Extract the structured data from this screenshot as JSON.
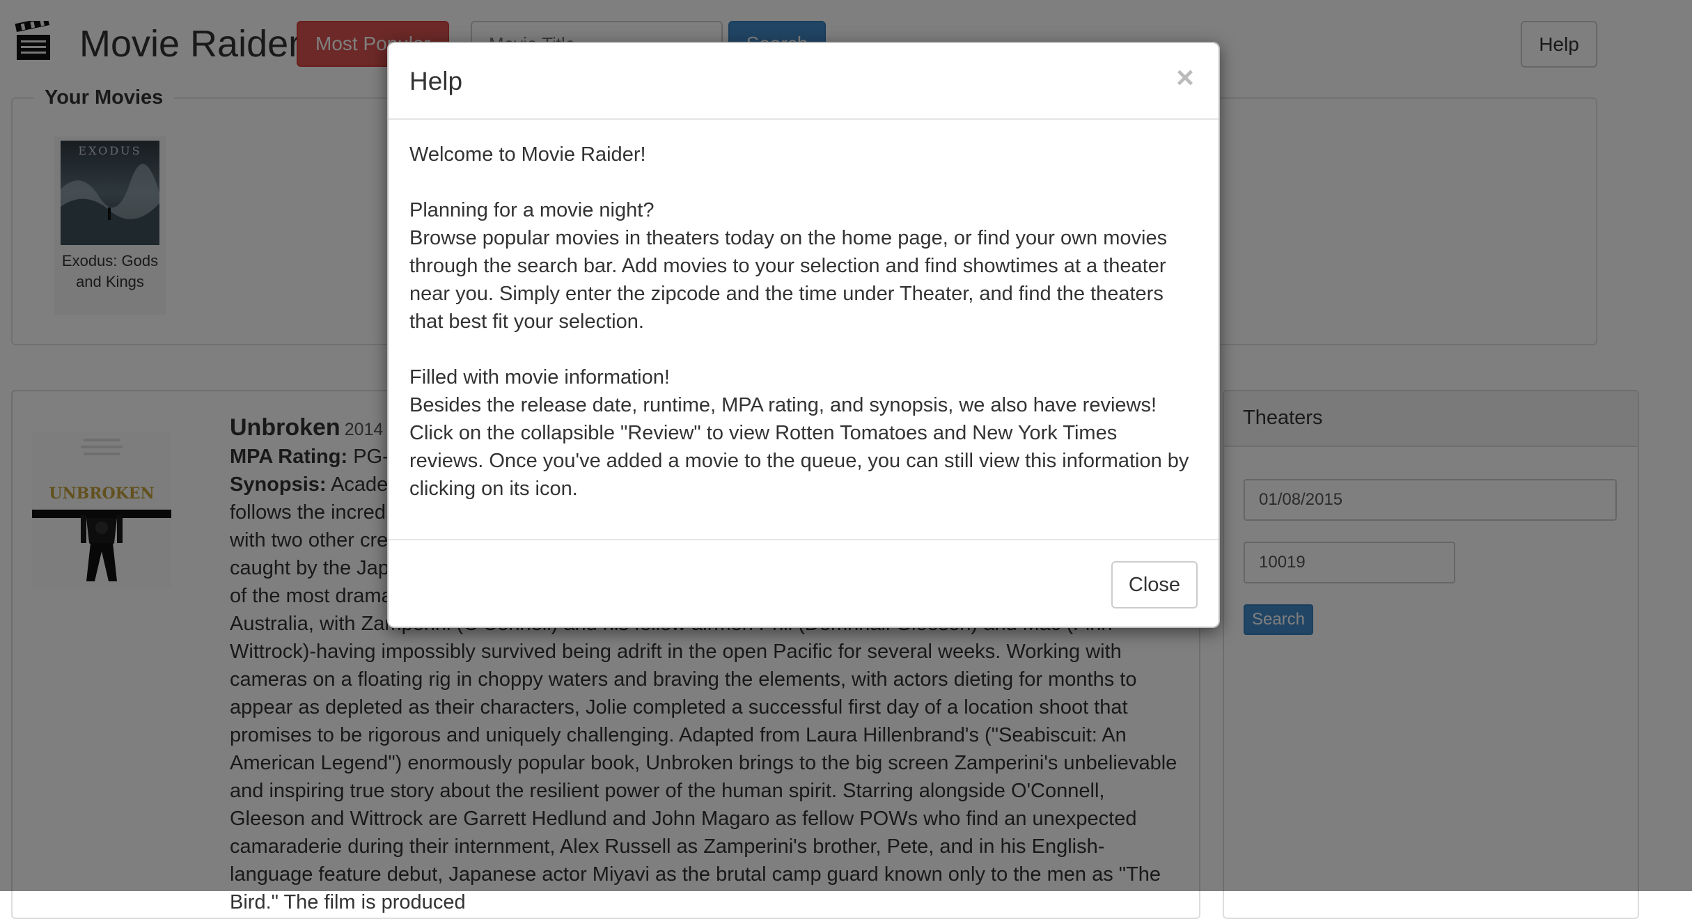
{
  "header": {
    "app_title": "Movie Raider",
    "icon": "clapperboard-icon",
    "most_popular_label": "Most Popular",
    "search_placeholder": "Movie Title",
    "search_label": "Search",
    "help_label": "Help"
  },
  "your_movies": {
    "heading": "Your Movies",
    "items": [
      {
        "title": "Exodus: Gods and Kings",
        "poster_text": "EXODUS"
      }
    ]
  },
  "movie": {
    "title": "Unbroken",
    "year": "2014",
    "rating_label": "MPA Rating:",
    "rating_value": "PG-13",
    "synopsis_label": "Synopsis:",
    "synopsis": "Academy Award winner Angelina Jolie directs and produces Unbroken, an epic drama that follows the incredible life of Olympian and war hero Louis \"Louie\" Zamperini (Jack O'Connell) who, along with two other crewmen, survived in a raft for 47 days after a near-fatal plane crash in WWII—only to be caught by the Japanese Navy and sent to a prisoner-of-war camp. Jolie and her team brought to life one of the most dramatic scenes of Unbroken during the first days of filming in October 2013 in Moreton Bay, Australia, with Zamperini (O'Connell) and his fellow airmen Phil (Domhnall Gleeson) and Mac (Finn Wittrock)-having impossibly survived being adrift in the open Pacific for several weeks. Working with cameras on a floating rig in choppy waters and braving the elements, with actors dieting for months to appear as depleted as their characters, Jolie completed a successful first day of a location shoot that promises to be rigorous and uniquely challenging. Adapted from Laura Hillenbrand's (\"Seabiscuit: An American Legend\") enormously popular book, Unbroken brings to the big screen Zamperini's unbelievable and inspiring true story about the resilient power of the human spirit. Starring alongside O'Connell, Gleeson and Wittrock are Garrett Hedlund and John Magaro as fellow POWs who find an unexpected camaraderie during their internment, Alex Russell as Zamperini's brother, Pete, and in his English-language feature debut, Japanese actor Miyavi as the brutal camp guard known only to the men as \"The Bird.\" The film is produced",
    "poster_text": "UNBROKEN"
  },
  "theaters": {
    "heading": "Theaters",
    "date_value": "01/08/2015",
    "zip_value": "10019",
    "search_label": "Search"
  },
  "modal": {
    "title": "Help",
    "close_x": "×",
    "welcome": "Welcome to Movie Raider!",
    "planning_heading": "Planning for a movie night?",
    "planning_text": "Browse popular movies in theaters today on the home page, or find your own movies through the search bar. Add movies to your selection and find showtimes at a theater near you. Simply enter the zipcode and the time under Theater, and find the theaters that best fit your selection.",
    "info_heading": "Filled with movie information!",
    "info_text": "Besides the release date, runtime, MPA rating, and synopsis, we also have reviews! Click on the collapsible \"Review\" to view Rotten Tomatoes and New York Times reviews. Once you've added a movie to the queue, you can still view this information by clicking on its icon.",
    "close_label": "Close"
  },
  "colors": {
    "danger": "#d9534f",
    "primary": "#428bca",
    "backdrop": "rgba(0,0,0,0.5)"
  }
}
